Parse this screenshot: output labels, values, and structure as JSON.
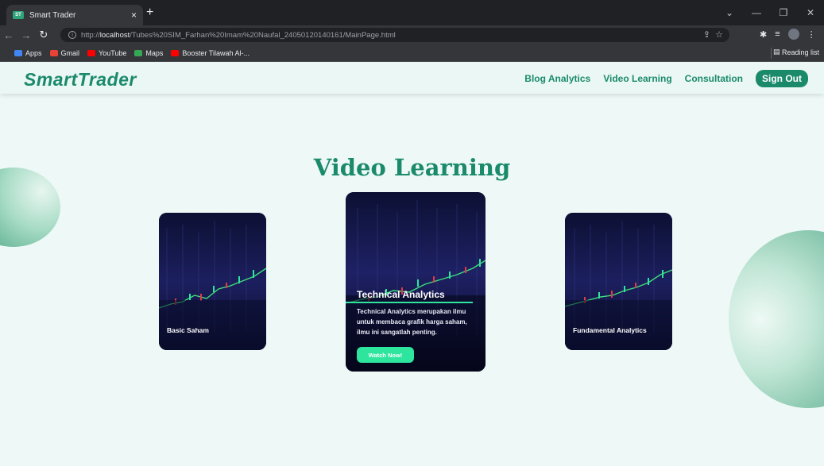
{
  "browser": {
    "tab_title": "Smart Trader",
    "tab_favicon_text": "ST",
    "tab_close": "×",
    "new_tab": "+",
    "url_prefix": "http://",
    "url_host": "localhost",
    "url_path": "/Tubes%20SIM_Farhan%20Imam%20Naufal_240501201401​61/MainPage.html",
    "bookmarks": [
      {
        "label": "Apps",
        "color": "#4285f4"
      },
      {
        "label": "Gmail",
        "color": "#ea4335"
      },
      {
        "label": "YouTube",
        "color": "#ff0000"
      },
      {
        "label": "Maps",
        "color": "#34a853"
      },
      {
        "label": "Booster Tilawah Al-...",
        "color": "#ff0000"
      }
    ],
    "reading_list": "Reading list"
  },
  "site": {
    "logo": "SmartTrader",
    "nav": {
      "blog": "Blog Analytics",
      "video": "Video Learning",
      "consultation": "Consultation",
      "signout": "Sign Out"
    },
    "section_title": "Video Learning",
    "cards": {
      "left_label": "Basic Saham",
      "center_title": "Technical Analytics",
      "center_desc": "Technical Analytics merupakan ilmu untuk membaca grafik harga saham, ilmu ini sangatlah penting.",
      "center_button": "Watch Now!",
      "right_label": "Fundamental Analytics"
    },
    "colors": {
      "brand": "#1b8a6b",
      "accent": "#2ee59d",
      "background": "#eef9f7"
    }
  }
}
